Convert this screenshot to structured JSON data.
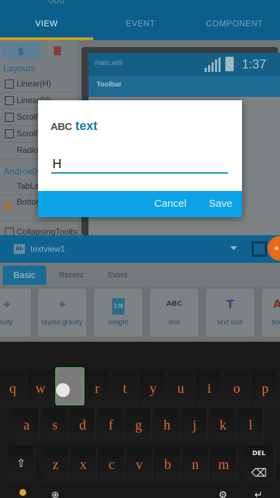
{
  "appbar": {
    "ghost_text": "606",
    "tabs": [
      "VIEW",
      "EVENT",
      "COMPONENT"
    ],
    "active_tab": "VIEW"
  },
  "palette": {
    "tab_icons": [
      "dollar-icon",
      "bookmark-icon"
    ],
    "tab_symbol": "$",
    "section_layouts": "Layouts",
    "items_layouts": [
      {
        "label": "Linear(H)",
        "icon": "linear-h-icon"
      },
      {
        "label": "Linear(V)",
        "icon": "linear-v-icon"
      },
      {
        "label": "ScrollView",
        "icon": "scroll-h-icon"
      },
      {
        "label": "ScrollView",
        "icon": "scroll-v-icon"
      },
      {
        "label": "RadioGroup",
        "icon": "radio-icon"
      }
    ],
    "section_androidx": "AndroidX",
    "items_androidx": [
      {
        "label": "TabLayout",
        "icon": "tab-layout-icon"
      },
      {
        "label": "BottomNavigationView",
        "icon": "home-icon"
      },
      {
        "label": "CollapsingToolbar",
        "icon": "collapsing-icon"
      }
    ]
  },
  "preview": {
    "file_name": "main.xml",
    "time": "1:37",
    "toolbar_label": "Toolbar"
  },
  "property_bar": {
    "widget_badge": "Ab",
    "widget_name": "textview1"
  },
  "property_tabs": [
    "Basic",
    "Recent",
    "Event"
  ],
  "property_cards": [
    {
      "label": "gravity",
      "icon": "gravity-icon",
      "glyph": "⌖"
    },
    {
      "label": "layout gravity",
      "icon": "layout-gravity-icon",
      "glyph": "⌖"
    },
    {
      "label": "weight",
      "icon": "weight-icon",
      "glyph": "1:N"
    },
    {
      "label": "text",
      "icon": "text-abc-icon",
      "glyph": "ABC"
    },
    {
      "label": "text size",
      "icon": "text-size-icon",
      "glyph": "T"
    },
    {
      "label": "text",
      "icon": "text-color-icon",
      "glyph": "A"
    }
  ],
  "dialog": {
    "icon_text": "ABC",
    "title": "text",
    "input_value": "H",
    "cancel_label": "Cancel",
    "save_label": "Save"
  },
  "keyboard": {
    "row1": [
      "q",
      "w",
      "e",
      "r",
      "t",
      "y",
      "u",
      "i",
      "o",
      "p"
    ],
    "row2": [
      "a",
      "s",
      "d",
      "f",
      "g",
      "h",
      "j",
      "k",
      "l"
    ],
    "row3": [
      "z",
      "x",
      "c",
      "v",
      "b",
      "n",
      "m"
    ],
    "del_label": "DEL",
    "pressed_key": "e"
  },
  "colors": {
    "primary": "#0b5f8a",
    "accent": "#0ba2e8",
    "fab": "#ea6a17",
    "key_text": "#e06a30"
  }
}
